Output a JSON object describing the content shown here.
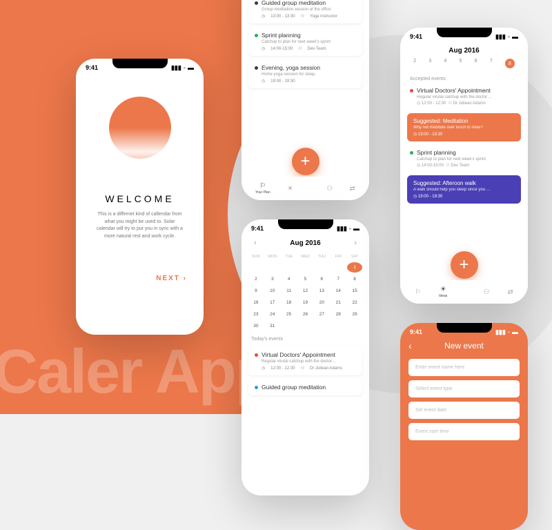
{
  "bg_text": "Caler\nApp",
  "status_time": "9:41",
  "colors": {
    "orange": "#ec774a",
    "purple": "#4a3fb5",
    "red": "#e74c3c",
    "green": "#27ae60",
    "blue": "#3498db",
    "darkblue": "#2c3e50"
  },
  "welcome": {
    "heading": "WELCOME",
    "body": "This is a differnet kind of callendar from what you might be used to. Solar calendar will try to put you in sync with a more natural rest and work cycle.",
    "next": "NEXT ›"
  },
  "events": [
    {
      "dot": "#e74c3c",
      "title": "Virtual Doctors' Appointment",
      "sub": "Regular virtual catchup with the doctor...",
      "time": "12:00 - 12:30",
      "who": "Dr Juliean Adams"
    },
    {
      "dot": "#2c3e50",
      "title": "Guided group meditation",
      "sub": "Group meditation session at the office",
      "time": "13:00 - 13:30",
      "who": "Yoga instructor"
    },
    {
      "dot": "#27ae60",
      "title": "Sprint planning",
      "sub": "Catchup to plan for next week's sprint",
      "time": "14:00-15:00",
      "who": "Dev Team"
    },
    {
      "dot": "#2c3e50",
      "title": "Evening, yoga session",
      "sub": "Home yoga session for sleep.",
      "time": "19:00 - 19:30",
      "who": ""
    }
  ],
  "nav": {
    "items": [
      "Your Plan",
      "Ideas",
      "",
      "",
      ""
    ]
  },
  "calendar": {
    "month": "Aug 2016",
    "dow": [
      "SUN",
      "MON",
      "TUE",
      "WED",
      "THU",
      "FRI",
      "SAT"
    ],
    "days": [
      "",
      "",
      "",
      "",
      "",
      "",
      "1",
      "2",
      "3",
      "4",
      "5",
      "6",
      "7",
      "8",
      "9",
      "10",
      "11",
      "12",
      "13",
      "14",
      "15",
      "16",
      "17",
      "18",
      "19",
      "20",
      "21",
      "22",
      "23",
      "24",
      "25",
      "26",
      "27",
      "28",
      "29",
      "30",
      "31",
      "",
      "",
      "",
      "",
      ""
    ],
    "selected": "1",
    "today_label": "Today's events",
    "today": [
      {
        "dot": "#e74c3c",
        "title": "Virtual Doctors' Appointment",
        "sub": "Regular virutal catchup with the doctor…",
        "time": "12:00 - 12:30",
        "who": "Dr Juliean Adams"
      },
      {
        "dot": "#3498db",
        "title": "Guided group meditation"
      }
    ]
  },
  "schedule": {
    "month": "Aug 2016",
    "week": [
      "2",
      "3",
      "4",
      "5",
      "6",
      "7",
      "8"
    ],
    "selected": "8",
    "accepted_label": "Accepted events",
    "items": [
      {
        "type": "event",
        "dot": "#e74c3c",
        "title": "Virtual Doctors' Appointment",
        "sub": "Regular virutal catchup with the doctor …",
        "time": "12:00 - 12:30",
        "who": "Dr Juliean Adams"
      },
      {
        "type": "suggest",
        "color": "orange",
        "title": "Suggested: Meditation",
        "sub": "Why not meditate over lunch to relax?",
        "time": "13:00 - 13:30"
      },
      {
        "type": "event",
        "dot": "#27ae60",
        "title": "Sprint planning",
        "sub": "Catchup to plan for next week's sprint",
        "time": "14:00-15:00",
        "who": "Dev Team"
      },
      {
        "type": "suggest",
        "color": "purple",
        "title": "Suggested: Afteroon walk",
        "sub": "A walk should help you sleep since you …",
        "time": "19:00 - 19:30"
      }
    ]
  },
  "newevent": {
    "title": "New event",
    "fields": [
      "Enter event name here",
      "Select event type",
      "Set event date",
      "Event start time"
    ]
  }
}
